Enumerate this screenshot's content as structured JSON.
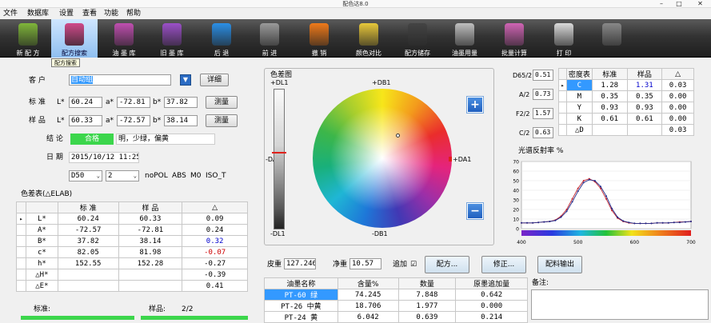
{
  "window": {
    "title": "配色达8.0",
    "min": "–",
    "max": "□",
    "close": "✕"
  },
  "menu": [
    "文件",
    "数据库",
    "设置",
    "查看",
    "功能",
    "帮助"
  ],
  "toolbar": [
    {
      "label": "新 配 方",
      "icon": "paint-bucket-icon",
      "color": "#7fb63a"
    },
    {
      "label": "配方搜索",
      "icon": "recipe-search-icon",
      "color": "#d04a8a",
      "active": true
    },
    {
      "label": "油 墨 库",
      "icon": "ink-library-icon",
      "color": "#c04fb0"
    },
    {
      "label": "旧 墨 库",
      "icon": "old-ink-icon",
      "color": "#9b50c8"
    },
    {
      "label": "后 退",
      "icon": "arrow-left-icon",
      "color": "#2b8fe6"
    },
    {
      "label": "前 进",
      "icon": "arrow-right-icon",
      "color": "#9a9a9a"
    },
    {
      "label": "撤 销",
      "icon": "undo-icon",
      "color": "#f07a1a"
    },
    {
      "label": "颜色对比",
      "icon": "color-compare-icon",
      "color": "#e8c83a"
    },
    {
      "label": "配方储存",
      "icon": "save-disk-icon",
      "color": "#444"
    },
    {
      "label": "油墨用量",
      "icon": "calculator-icon",
      "color": "#bfbfbf"
    },
    {
      "label": "批量计算",
      "icon": "batch-calc-icon",
      "color": "#d064b4"
    },
    {
      "label": "打 印",
      "icon": "printer-icon",
      "color": "#dadada"
    },
    {
      "label": "",
      "icon": "spectro-device-icon",
      "color": "#888"
    }
  ],
  "tooltip": "配方搜索",
  "customer": {
    "label": "客 户",
    "value": "自动组",
    "browse": "详细"
  },
  "standard": {
    "label": "标 准",
    "L": "60.24",
    "a": "-72.81",
    "b": "37.82",
    "measure": "测量"
  },
  "sample": {
    "label": "样 品",
    "L": "60.33",
    "a": "-72.57",
    "b": "38.14",
    "measure": "测量"
  },
  "coord": {
    "L": "L*",
    "a": "a*",
    "b": "b*"
  },
  "conclusion": {
    "label": "结 论",
    "badge": "合格",
    "text": "明，少绿，偏黄"
  },
  "date": {
    "label": "日 期",
    "value": "2015/10/12 11:25:0"
  },
  "options": {
    "illum": "D50",
    "observer": "2",
    "pol": "noPOL",
    "abs": "ABS",
    "m0": "M0",
    "iso": "ISO_T"
  },
  "diff_table": {
    "title": "色差表(△ELAB)",
    "headers": [
      "",
      "标 准",
      "样 品",
      "△"
    ],
    "rows": [
      {
        "mark": "▸",
        "name": "L*",
        "std": "60.24",
        "smp": "60.33",
        "d": "0.09",
        "color": "#000"
      },
      {
        "mark": "",
        "name": "A*",
        "std": "-72.57",
        "smp": "-72.81",
        "d": "0.24",
        "color": "#000"
      },
      {
        "mark": "",
        "name": "B*",
        "std": "37.82",
        "smp": "38.14",
        "d": "0.32",
        "color": "#0000cc"
      },
      {
        "mark": "",
        "name": "c*",
        "std": "82.05",
        "smp": "81.98",
        "d": "-0.07",
        "color": "#cc0000"
      },
      {
        "mark": "",
        "name": "h*",
        "std": "152.55",
        "smp": "152.28",
        "d": "-0.27",
        "color": "#000"
      },
      {
        "mark": "",
        "name": "△H*",
        "std": "",
        "smp": "",
        "d": "-0.39",
        "color": "#000"
      },
      {
        "mark": "",
        "name": "△E*",
        "std": "",
        "smp": "",
        "d": "0.41",
        "color": "#000"
      }
    ]
  },
  "bottom_left": {
    "std_label": "标准:",
    "smp_label": "样品:",
    "smp_count": "2/2"
  },
  "colorwheel": {
    "title": "色差图",
    "dl1_top": "+DL1",
    "dl1_bottom": "-DL1",
    "db1_top": "+DB1",
    "db1_bottom": "-DB1",
    "da1_left": "-DA1",
    "da1_right": "+DA1",
    "plus": "+",
    "minus": "−"
  },
  "recipe_inputs": {
    "skin_label": "皮重",
    "skin": "127.246",
    "net_label": "净重",
    "net": "10.57",
    "add_label": "追加",
    "add_check": "☑",
    "recipe_btn": "配方...",
    "correct_btn": "修正...",
    "export_btn": "配料输出"
  },
  "ink_table": {
    "headers": [
      "油墨名称",
      "含量%",
      "数量",
      "原墨追加量"
    ],
    "rows": [
      {
        "name": "PT-60 绿",
        "pct": "74.245",
        "qty": "7.848",
        "add": "0.642",
        "selected": true
      },
      {
        "name": "PT-26 中黄",
        "pct": "18.706",
        "qty": "1.977",
        "add": "0.000",
        "selected": false
      },
      {
        "name": "PT-24 黄",
        "pct": "6.042",
        "qty": "0.639",
        "add": "0.214",
        "selected": false
      }
    ]
  },
  "notes": {
    "label": "备注:"
  },
  "density": {
    "d65": "D65/2",
    "d65v": "0.51",
    "a2": "A/2",
    "a2v": "0.73",
    "f2": "F2/2",
    "f2v": "1.57",
    "c2": "C/2",
    "c2v": "0.63",
    "headers": [
      "",
      "密度表",
      "标准",
      "样品",
      "△"
    ],
    "rows": [
      {
        "mark": "▸",
        "ch": "C",
        "std": "1.28",
        "smp": "1.31",
        "d": "0.03",
        "hl": true
      },
      {
        "mark": "",
        "ch": "M",
        "std": "0.35",
        "smp": "0.35",
        "d": "0.00",
        "hl": false
      },
      {
        "mark": "",
        "ch": "Y",
        "std": "0.93",
        "smp": "0.93",
        "d": "0.00",
        "hl": false
      },
      {
        "mark": "",
        "ch": "K",
        "std": "0.61",
        "smp": "0.61",
        "d": "0.00",
        "hl": false
      },
      {
        "mark": "",
        "ch": "△D",
        "std": "",
        "smp": "",
        "d": "0.03",
        "hl": false
      }
    ]
  },
  "chart_data": {
    "type": "line",
    "title": "光谱反射率 %",
    "xlim": [
      400,
      700
    ],
    "ylim": [
      0,
      70
    ],
    "xticks": [
      "400",
      "500",
      "600",
      "700"
    ],
    "yticks": [
      "70",
      "60",
      "50",
      "40",
      "30",
      "20",
      "10",
      "0"
    ],
    "series": [
      {
        "name": "",
        "color": "#c0202a",
        "x": [
          400,
          410,
          420,
          430,
          440,
          450,
          460,
          470,
          480,
          490,
          500,
          510,
          520,
          530,
          540,
          550,
          560,
          570,
          580,
          590,
          600,
          610,
          620,
          630,
          640,
          650,
          660,
          670,
          680,
          690,
          700
        ],
        "y": [
          6,
          6,
          6,
          6.5,
          7,
          7.5,
          9,
          13,
          20,
          31,
          42,
          50,
          52,
          49,
          42,
          31,
          19,
          11,
          7.5,
          6,
          5.5,
          5.5,
          5.5,
          5.5,
          6,
          6,
          6,
          6.5,
          7,
          7,
          7.5
        ]
      },
      {
        "name": "",
        "color": "#1f2a8a",
        "x": [
          400,
          410,
          420,
          430,
          440,
          450,
          460,
          470,
          480,
          490,
          500,
          510,
          520,
          530,
          540,
          550,
          560,
          570,
          580,
          590,
          600,
          610,
          620,
          630,
          640,
          650,
          660,
          670,
          680,
          690,
          700
        ],
        "y": [
          6,
          6,
          6,
          6.5,
          7,
          7.5,
          8.5,
          12,
          18,
          28,
          39,
          48,
          51,
          50,
          44,
          34,
          21,
          12,
          8,
          6.5,
          5.5,
          5.5,
          5.5,
          5.5,
          6,
          6,
          6,
          6.5,
          6.5,
          7,
          7.5
        ]
      }
    ]
  }
}
